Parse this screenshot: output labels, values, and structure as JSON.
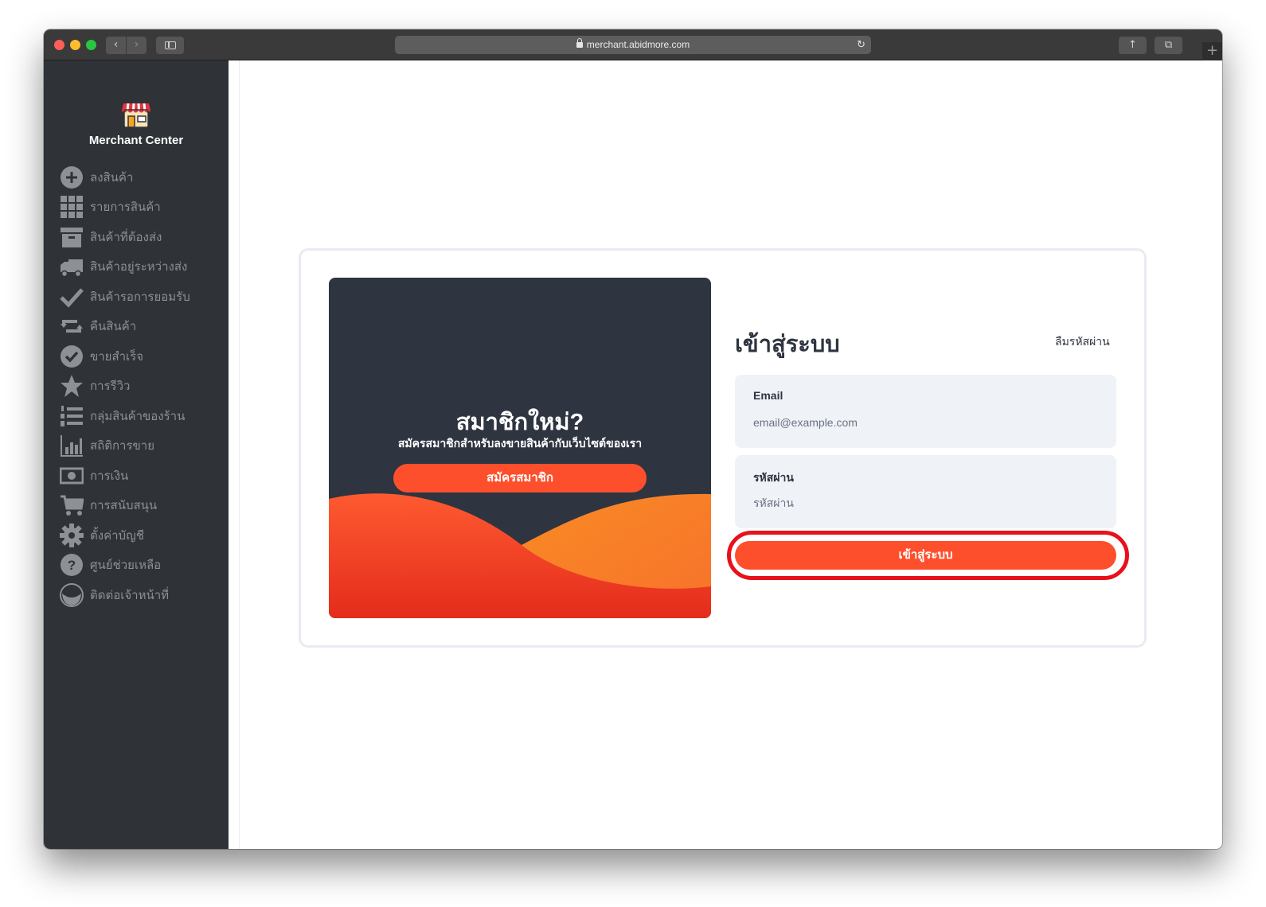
{
  "browser": {
    "url": "merchant.abidmore.com",
    "nav_back_icon": "chevron-left-icon",
    "nav_forward_icon": "chevron-right-icon",
    "reload_icon": "reload-icon",
    "share_icon": "share-icon",
    "tabs_icon": "tabs-overview-icon",
    "new_tab_label": "+"
  },
  "sidebar": {
    "brand_title": "Merchant Center",
    "brand_icon": "store-icon",
    "items": [
      {
        "label": "ลงสินค้า",
        "icon": "plus-circle-icon"
      },
      {
        "label": "รายการสินค้า",
        "icon": "grid-icon"
      },
      {
        "label": "สินค้าที่ต้องส่ง",
        "icon": "archive-box-icon"
      },
      {
        "label": "สินค้าอยู่ระหว่างส่ง",
        "icon": "truck-icon"
      },
      {
        "label": "สินค้ารอการยอมรับ",
        "icon": "checkmark-icon"
      },
      {
        "label": "คืนสินค้า",
        "icon": "return-arrows-icon"
      },
      {
        "label": "ขายสำเร็จ",
        "icon": "check-circle-icon"
      },
      {
        "label": "การรีวิว",
        "icon": "star-icon"
      },
      {
        "label": "กลุ่มสินค้าของร้าน",
        "icon": "numbered-list-icon"
      },
      {
        "label": "สถิติการขาย",
        "icon": "bar-chart-icon"
      },
      {
        "label": "การเงิน",
        "icon": "money-icon"
      },
      {
        "label": "การสนับสนุน",
        "icon": "cart-icon"
      },
      {
        "label": "ตั้งค่าบัญชี",
        "icon": "gear-icon"
      },
      {
        "label": "ศูนย์ช่วยเหลือ",
        "icon": "help-circle-icon"
      },
      {
        "label": "ติดต่อเจ้าหน้าที่",
        "icon": "contact-icon"
      }
    ]
  },
  "promo": {
    "title": "สมาชิกใหม่?",
    "subtitle": "สมัครสมาชิกสำหรับลงขายสินค้ากับเว็บไซต์ของเรา",
    "signup_label": "สมัครสมาชิก"
  },
  "login": {
    "title": "เข้าสู่ระบบ",
    "forgot_label": "ลืมรหัสผ่าน",
    "email_label": "Email",
    "email_placeholder": "email@example.com",
    "password_label": "รหัสผ่าน",
    "password_placeholder": "รหัสผ่าน",
    "submit_label": "เข้าสู่ระบบ"
  },
  "colors": {
    "accent": "#fe4f2d",
    "sidebar_bg": "#2f3236",
    "promo_bg": "#2e3440",
    "highlight": "#e8111b"
  }
}
